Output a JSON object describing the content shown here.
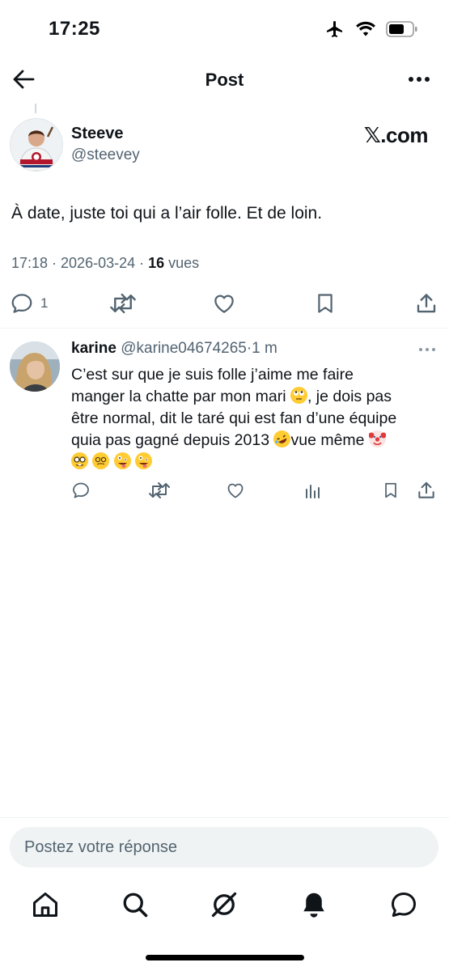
{
  "status_bar": {
    "time": "17:25"
  },
  "header": {
    "title": "Post"
  },
  "post": {
    "author_name": "Steeve",
    "author_handle": "@steevey",
    "source": "𝕏.com",
    "text": "À date, juste toi qui a l’air folle. Et de loin.",
    "time": "17:18 · 2026-03-24 · ",
    "views_count": "16",
    "views_label": " vues",
    "reply_count": "1"
  },
  "reply": {
    "author_name": "karine",
    "author_handle": "@karine04674265",
    "time_ago": "·1 m",
    "text_line1": "C’est sur que je suis folle j’aime me faire",
    "text_line2": "manger la chatte par mon mari ",
    "text_line2b": ", je dois pas",
    "text_line3": "être normal, dit le taré qui est fan d’une équipe",
    "text_line4": "quia pas gagné depuis 2013 ",
    "text_line4b": "vue même "
  },
  "composer": {
    "placeholder": "Postez votre réponse"
  },
  "icons": {
    "back": "arrow-left-icon",
    "more": "ellipsis-icon",
    "reply": "comment-icon",
    "repost": "repost-icon",
    "like": "heart-icon",
    "bookmark": "bookmark-icon",
    "share": "share-icon",
    "views": "analytics-icon",
    "home": "home-icon",
    "search": "search-icon",
    "grok": "grok-icon",
    "notifications": "bell-icon",
    "messages": "messages-icon"
  },
  "colors": {
    "text": "#0f1419",
    "secondary": "#536471",
    "divider": "#eff3f4"
  }
}
